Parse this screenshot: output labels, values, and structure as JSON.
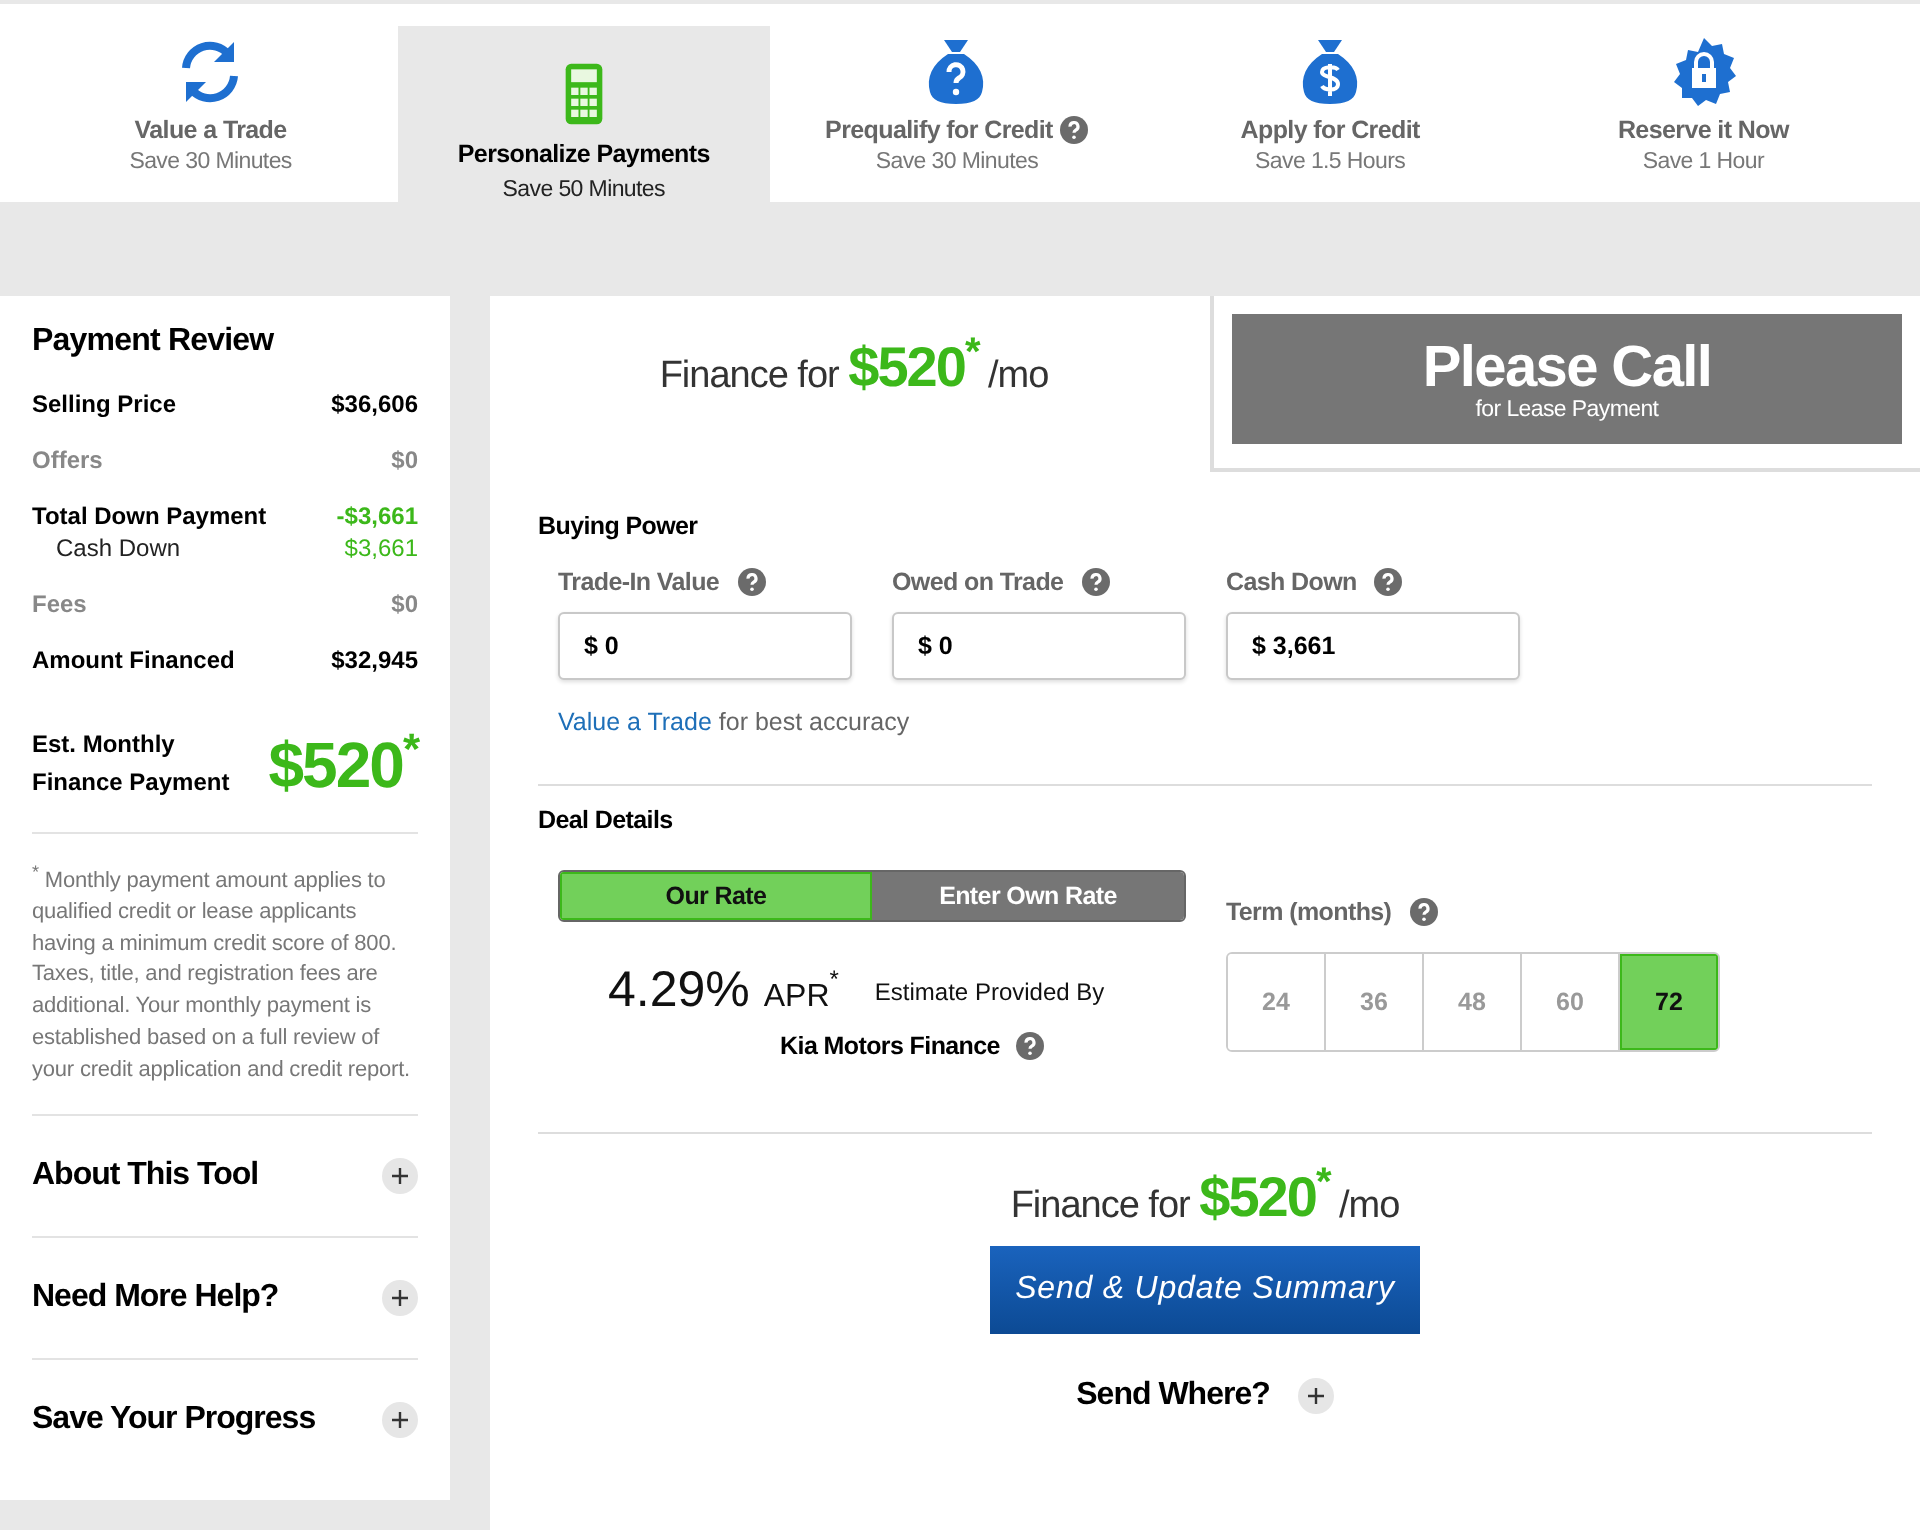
{
  "steps": [
    {
      "kind": "refresh",
      "label": "Value a Trade",
      "sub": "Save 30 Minutes",
      "selected": false,
      "help": false
    },
    {
      "kind": "calculator",
      "label": "Personalize Payments",
      "sub": "Save 50 Minutes",
      "selected": true,
      "help": false
    },
    {
      "kind": "question-bag",
      "label": "Prequalify for Credit",
      "sub": "Save 30 Minutes",
      "selected": false,
      "help": true
    },
    {
      "kind": "dollar-bag",
      "label": "Apply for Credit",
      "sub": "Save 1.5 Hours",
      "selected": false,
      "help": false
    },
    {
      "kind": "lock-badge",
      "label": "Reserve it Now",
      "sub": "Save 1 Hour",
      "selected": false,
      "help": false
    }
  ],
  "review": {
    "title": "Payment Review",
    "rows": [
      {
        "kind": "main",
        "label": "Selling Price",
        "value": "$36,606"
      },
      {
        "kind": "muted",
        "label": "Offers",
        "value": "$0"
      },
      {
        "kind": "credit",
        "label": "Total Down Payment",
        "value": "-$3,661"
      },
      {
        "kind": "sub",
        "label": "Cash Down",
        "value": "$3,661"
      },
      {
        "kind": "muted",
        "label": "Fees",
        "value": "$0"
      },
      {
        "kind": "main",
        "label": "Amount Financed",
        "value": "$32,945"
      }
    ],
    "estimate": {
      "label": "Est. Monthly Finance Payment",
      "amount": "$520",
      "mark": "*"
    },
    "footnote": "$^{*}$ Monthly payment amount applies to qualified credit or lease applicants having a minimum credit score of 800.  Taxes, title, and registration fees are additional. Your monthly payment is established based on a full review of your credit application and credit report.",
    "sections": [
      {
        "title": "About This Tool",
        "expanded": false
      },
      {
        "title": "Need More Help?",
        "expanded": false
      },
      {
        "title": "Save Your Progress",
        "expanded": false
      }
    ]
  },
  "finance_top": {
    "prefix": "Finance for",
    "amount": "$520",
    "mark": "*",
    "suffix": "/mo"
  },
  "lease": {
    "title": "Please Call",
    "subtitle": "for Lease Payment"
  },
  "buying_power": {
    "title": "Buying Power",
    "fields": [
      {
        "label": "Trade-In Value",
        "value": "$ 0"
      },
      {
        "label": "Owed on Trade",
        "value": "$ 0"
      },
      {
        "label": "Cash Down",
        "value": "$ 3,661"
      }
    ],
    "link": "Value a Trade",
    "link_suffix": "for best accuracy"
  },
  "deal_details": {
    "title": "Deal Details",
    "rate_tabs": [
      {
        "label": "Our Rate",
        "selected": true
      },
      {
        "label": "Enter Own Rate",
        "selected": false
      }
    ],
    "apr": "4.29%",
    "apr_label": "APR",
    "apr_mark": "*",
    "provider_label": "Estimate Provided By",
    "provider": "Kia Motors Finance",
    "term_label": "Term (months)",
    "terms": [
      {
        "label": "24",
        "selected": false
      },
      {
        "label": "36",
        "selected": false
      },
      {
        "label": "48",
        "selected": false
      },
      {
        "label": "60",
        "selected": false
      },
      {
        "label": "72",
        "selected": true
      }
    ]
  },
  "finance_bottom": {
    "prefix": "Finance for",
    "amount": "$520",
    "mark": "*",
    "suffix": "/mo"
  },
  "send_button": "Send & Update Summary",
  "send_where": {
    "title": "Send Where?",
    "expanded": false
  }
}
